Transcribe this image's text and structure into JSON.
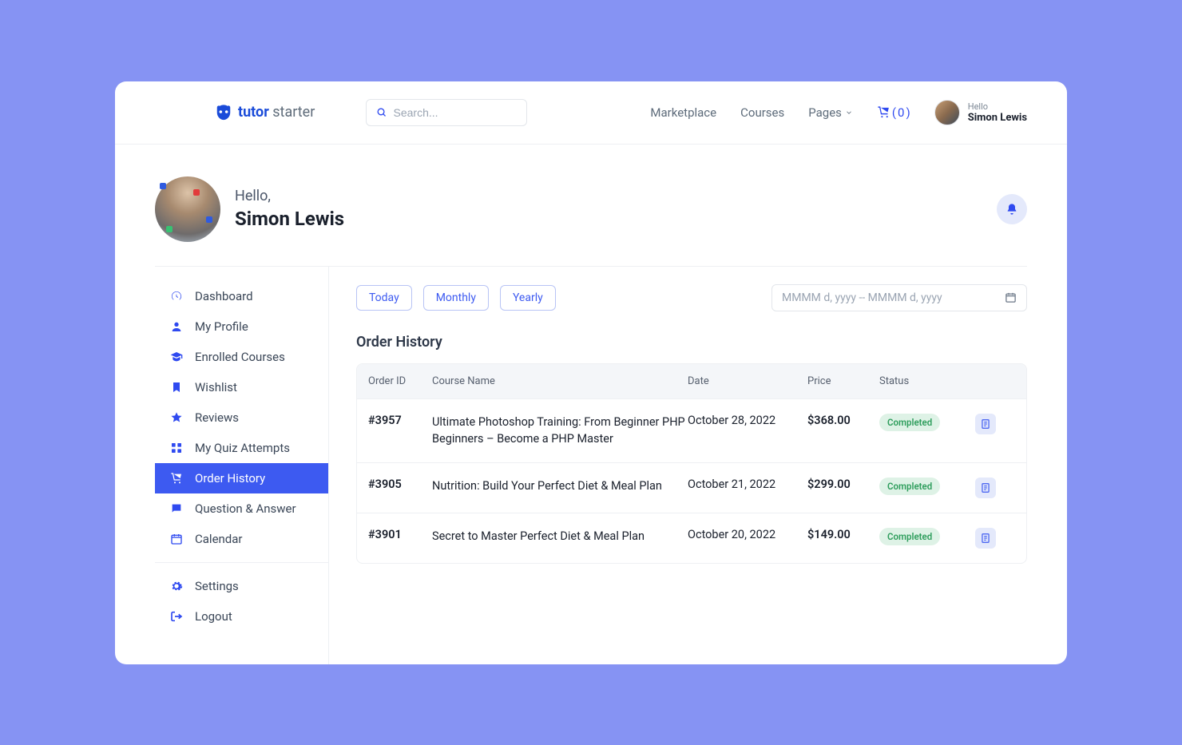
{
  "brand": {
    "strong": "tutor",
    "light": "starter"
  },
  "search": {
    "placeholder": "Search..."
  },
  "nav": {
    "marketplace": "Marketplace",
    "courses": "Courses",
    "pages": "Pages"
  },
  "cart": {
    "count": "0"
  },
  "user": {
    "greeting_small": "Hello",
    "name": "Simon Lewis"
  },
  "hero": {
    "hello": "Hello,",
    "name": "Simon Lewis"
  },
  "sidebar": {
    "items": [
      {
        "label": "Dashboard"
      },
      {
        "label": "My Profile"
      },
      {
        "label": "Enrolled Courses"
      },
      {
        "label": "Wishlist"
      },
      {
        "label": "Reviews"
      },
      {
        "label": "My Quiz Attempts"
      },
      {
        "label": "Order History"
      },
      {
        "label": "Question & Answer"
      },
      {
        "label": "Calendar"
      }
    ],
    "footer": [
      {
        "label": "Settings"
      },
      {
        "label": "Logout"
      }
    ]
  },
  "filters": {
    "today": "Today",
    "monthly": "Monthly",
    "yearly": "Yearly",
    "date_placeholder": "MMMM d, yyyy -- MMMM d, yyyy"
  },
  "section": {
    "title": "Order History"
  },
  "table": {
    "headers": {
      "order_id": "Order ID",
      "course": "Course Name",
      "date": "Date",
      "price": "Price",
      "status": "Status"
    },
    "rows": [
      {
        "id": "#3957",
        "course": "Ultimate Photoshop Training: From Beginner PHP Beginners – Become a PHP Master",
        "date": "October 28, 2022",
        "price": "$368.00",
        "status": "Completed"
      },
      {
        "id": "#3905",
        "course": "Nutrition: Build Your Perfect Diet & Meal Plan",
        "date": "October 21, 2022",
        "price": "$299.00",
        "status": "Completed"
      },
      {
        "id": "#3901",
        "course": "Secret to Master Perfect Diet & Meal Plan",
        "date": "October 20, 2022",
        "price": "$149.00",
        "status": "Completed"
      }
    ]
  }
}
